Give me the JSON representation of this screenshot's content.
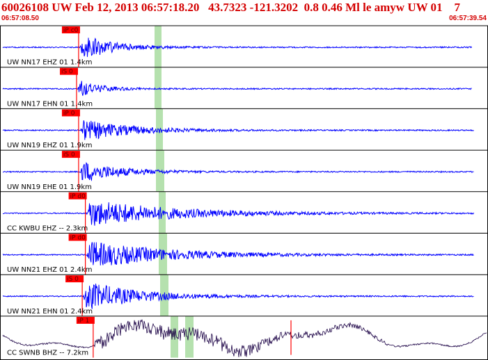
{
  "header": {
    "title": "60026108 UW Feb 12, 2013 06:57:18.20   43.7323 -121.3202  0.8 0.46 Ml le amyw UW 01    7",
    "time_start": "06:57:08.50",
    "time_end": "06:57:39.54"
  },
  "colors": {
    "trace": "#0000ff",
    "trace_last": "#1a0044",
    "pick": "#ff0000",
    "shade": "#a8dca0",
    "title": "#d40000",
    "frame": "#000000"
  },
  "traces": [
    {
      "label": "UW NN17 EHZ 01 1.4km",
      "pick": "iP c0",
      "pick_time": 4.97
    },
    {
      "label": "UW NN17 EHN 01 1.4km",
      "pick": "iS 0",
      "pick_time": 4.84
    },
    {
      "label": "UW NN19 EHZ 01 1.9km",
      "pick": "iP 0",
      "pick_time": 4.97
    },
    {
      "label": "UW NN19 EHE 01 1.9km",
      "pick": "iS 0",
      "pick_time": 4.97
    },
    {
      "label": "CC KWBU EHZ -- 2.3km",
      "pick": "iP d0",
      "pick_time": 5.4
    },
    {
      "label": "UW NN21 EHZ 01 2.4km",
      "pick": "iP d0",
      "pick_time": 5.4
    },
    {
      "label": "UW NN21 EHN 01 2.4km",
      "pick": "iS 0",
      "pick_time": 5.2
    },
    {
      "label": "CC SWNB BHZ -- 7.2km",
      "pick": "iP 1",
      "pick_time": 5.9
    }
  ]
}
